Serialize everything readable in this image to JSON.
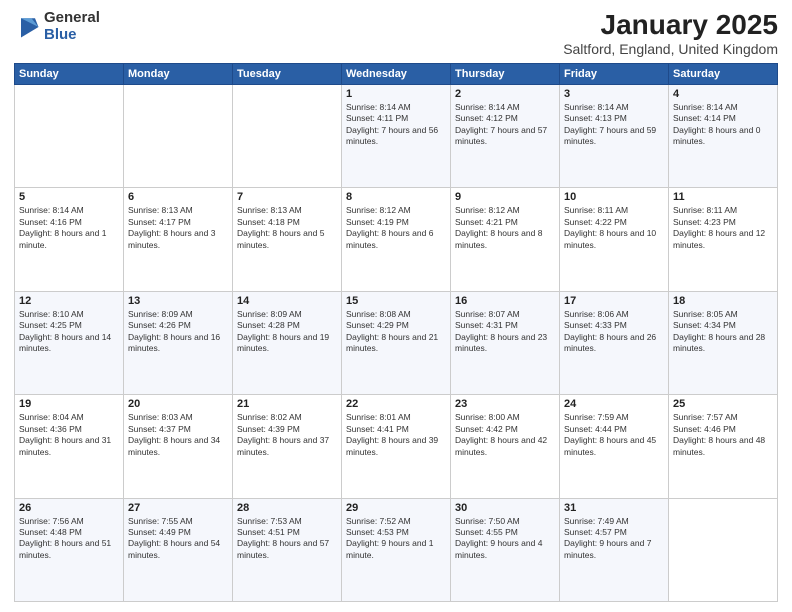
{
  "logo": {
    "general": "General",
    "blue": "Blue"
  },
  "title": "January 2025",
  "location": "Saltford, England, United Kingdom",
  "weekdays": [
    "Sunday",
    "Monday",
    "Tuesday",
    "Wednesday",
    "Thursday",
    "Friday",
    "Saturday"
  ],
  "weeks": [
    [
      {
        "day": "",
        "info": ""
      },
      {
        "day": "",
        "info": ""
      },
      {
        "day": "",
        "info": ""
      },
      {
        "day": "1",
        "info": "Sunrise: 8:14 AM\nSunset: 4:11 PM\nDaylight: 7 hours and 56 minutes."
      },
      {
        "day": "2",
        "info": "Sunrise: 8:14 AM\nSunset: 4:12 PM\nDaylight: 7 hours and 57 minutes."
      },
      {
        "day": "3",
        "info": "Sunrise: 8:14 AM\nSunset: 4:13 PM\nDaylight: 7 hours and 59 minutes."
      },
      {
        "day": "4",
        "info": "Sunrise: 8:14 AM\nSunset: 4:14 PM\nDaylight: 8 hours and 0 minutes."
      }
    ],
    [
      {
        "day": "5",
        "info": "Sunrise: 8:14 AM\nSunset: 4:16 PM\nDaylight: 8 hours and 1 minute."
      },
      {
        "day": "6",
        "info": "Sunrise: 8:13 AM\nSunset: 4:17 PM\nDaylight: 8 hours and 3 minutes."
      },
      {
        "day": "7",
        "info": "Sunrise: 8:13 AM\nSunset: 4:18 PM\nDaylight: 8 hours and 5 minutes."
      },
      {
        "day": "8",
        "info": "Sunrise: 8:12 AM\nSunset: 4:19 PM\nDaylight: 8 hours and 6 minutes."
      },
      {
        "day": "9",
        "info": "Sunrise: 8:12 AM\nSunset: 4:21 PM\nDaylight: 8 hours and 8 minutes."
      },
      {
        "day": "10",
        "info": "Sunrise: 8:11 AM\nSunset: 4:22 PM\nDaylight: 8 hours and 10 minutes."
      },
      {
        "day": "11",
        "info": "Sunrise: 8:11 AM\nSunset: 4:23 PM\nDaylight: 8 hours and 12 minutes."
      }
    ],
    [
      {
        "day": "12",
        "info": "Sunrise: 8:10 AM\nSunset: 4:25 PM\nDaylight: 8 hours and 14 minutes."
      },
      {
        "day": "13",
        "info": "Sunrise: 8:09 AM\nSunset: 4:26 PM\nDaylight: 8 hours and 16 minutes."
      },
      {
        "day": "14",
        "info": "Sunrise: 8:09 AM\nSunset: 4:28 PM\nDaylight: 8 hours and 19 minutes."
      },
      {
        "day": "15",
        "info": "Sunrise: 8:08 AM\nSunset: 4:29 PM\nDaylight: 8 hours and 21 minutes."
      },
      {
        "day": "16",
        "info": "Sunrise: 8:07 AM\nSunset: 4:31 PM\nDaylight: 8 hours and 23 minutes."
      },
      {
        "day": "17",
        "info": "Sunrise: 8:06 AM\nSunset: 4:33 PM\nDaylight: 8 hours and 26 minutes."
      },
      {
        "day": "18",
        "info": "Sunrise: 8:05 AM\nSunset: 4:34 PM\nDaylight: 8 hours and 28 minutes."
      }
    ],
    [
      {
        "day": "19",
        "info": "Sunrise: 8:04 AM\nSunset: 4:36 PM\nDaylight: 8 hours and 31 minutes."
      },
      {
        "day": "20",
        "info": "Sunrise: 8:03 AM\nSunset: 4:37 PM\nDaylight: 8 hours and 34 minutes."
      },
      {
        "day": "21",
        "info": "Sunrise: 8:02 AM\nSunset: 4:39 PM\nDaylight: 8 hours and 37 minutes."
      },
      {
        "day": "22",
        "info": "Sunrise: 8:01 AM\nSunset: 4:41 PM\nDaylight: 8 hours and 39 minutes."
      },
      {
        "day": "23",
        "info": "Sunrise: 8:00 AM\nSunset: 4:42 PM\nDaylight: 8 hours and 42 minutes."
      },
      {
        "day": "24",
        "info": "Sunrise: 7:59 AM\nSunset: 4:44 PM\nDaylight: 8 hours and 45 minutes."
      },
      {
        "day": "25",
        "info": "Sunrise: 7:57 AM\nSunset: 4:46 PM\nDaylight: 8 hours and 48 minutes."
      }
    ],
    [
      {
        "day": "26",
        "info": "Sunrise: 7:56 AM\nSunset: 4:48 PM\nDaylight: 8 hours and 51 minutes."
      },
      {
        "day": "27",
        "info": "Sunrise: 7:55 AM\nSunset: 4:49 PM\nDaylight: 8 hours and 54 minutes."
      },
      {
        "day": "28",
        "info": "Sunrise: 7:53 AM\nSunset: 4:51 PM\nDaylight: 8 hours and 57 minutes."
      },
      {
        "day": "29",
        "info": "Sunrise: 7:52 AM\nSunset: 4:53 PM\nDaylight: 9 hours and 1 minute."
      },
      {
        "day": "30",
        "info": "Sunrise: 7:50 AM\nSunset: 4:55 PM\nDaylight: 9 hours and 4 minutes."
      },
      {
        "day": "31",
        "info": "Sunrise: 7:49 AM\nSunset: 4:57 PM\nDaylight: 9 hours and 7 minutes."
      },
      {
        "day": "",
        "info": ""
      }
    ]
  ]
}
